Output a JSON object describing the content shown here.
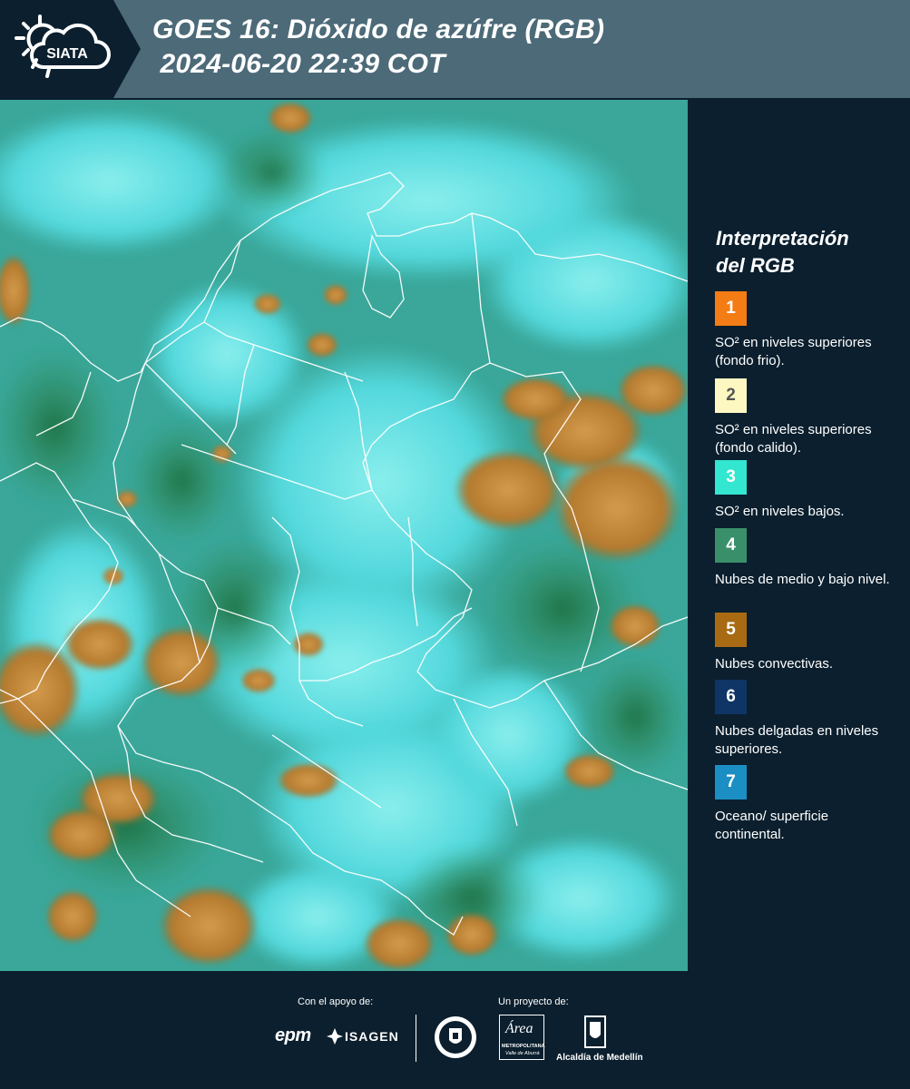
{
  "header": {
    "logo_text": "SIATA",
    "title_line1": "GOES 16: Dióxido de azúfre (RGB)",
    "title_line2": " 2024-06-20 22:39 COT"
  },
  "legend": {
    "title_line1": "Interpretación",
    "title_line2": "del RGB",
    "items": [
      {
        "number": "1",
        "color": "#f47c14",
        "label": "SO² en niveles superiores (fondo frio)."
      },
      {
        "number": "2",
        "color": "#fdf7c2",
        "label": "SO² en niveles superiores (fondo calido)."
      },
      {
        "number": "3",
        "color": "#33e6d0",
        "label": "SO² en niveles bajos."
      },
      {
        "number": "4",
        "color": "#3a8f6b",
        "label": "Nubes de medio y bajo nivel."
      },
      {
        "number": "5",
        "color": "#a86a12",
        "label": "Nubes convectivas."
      },
      {
        "number": "6",
        "color": "#0f3566",
        "label": "Nubes delgadas en niveles superiores."
      },
      {
        "number": "7",
        "color": "#1b8fc4",
        "label": "Oceano/ superficie continental."
      }
    ]
  },
  "footer": {
    "support_label": "Con el apoyo de:",
    "project_label": "Un proyecto de:",
    "sponsor_epm": "epm",
    "sponsor_isagen": "ISAGEN",
    "metro_name": "Área",
    "metro_sub1": "METROPOLITANA",
    "metro_sub2": "Valle de Aburrá",
    "alcaldia": "Alcaldía de Medellín"
  }
}
